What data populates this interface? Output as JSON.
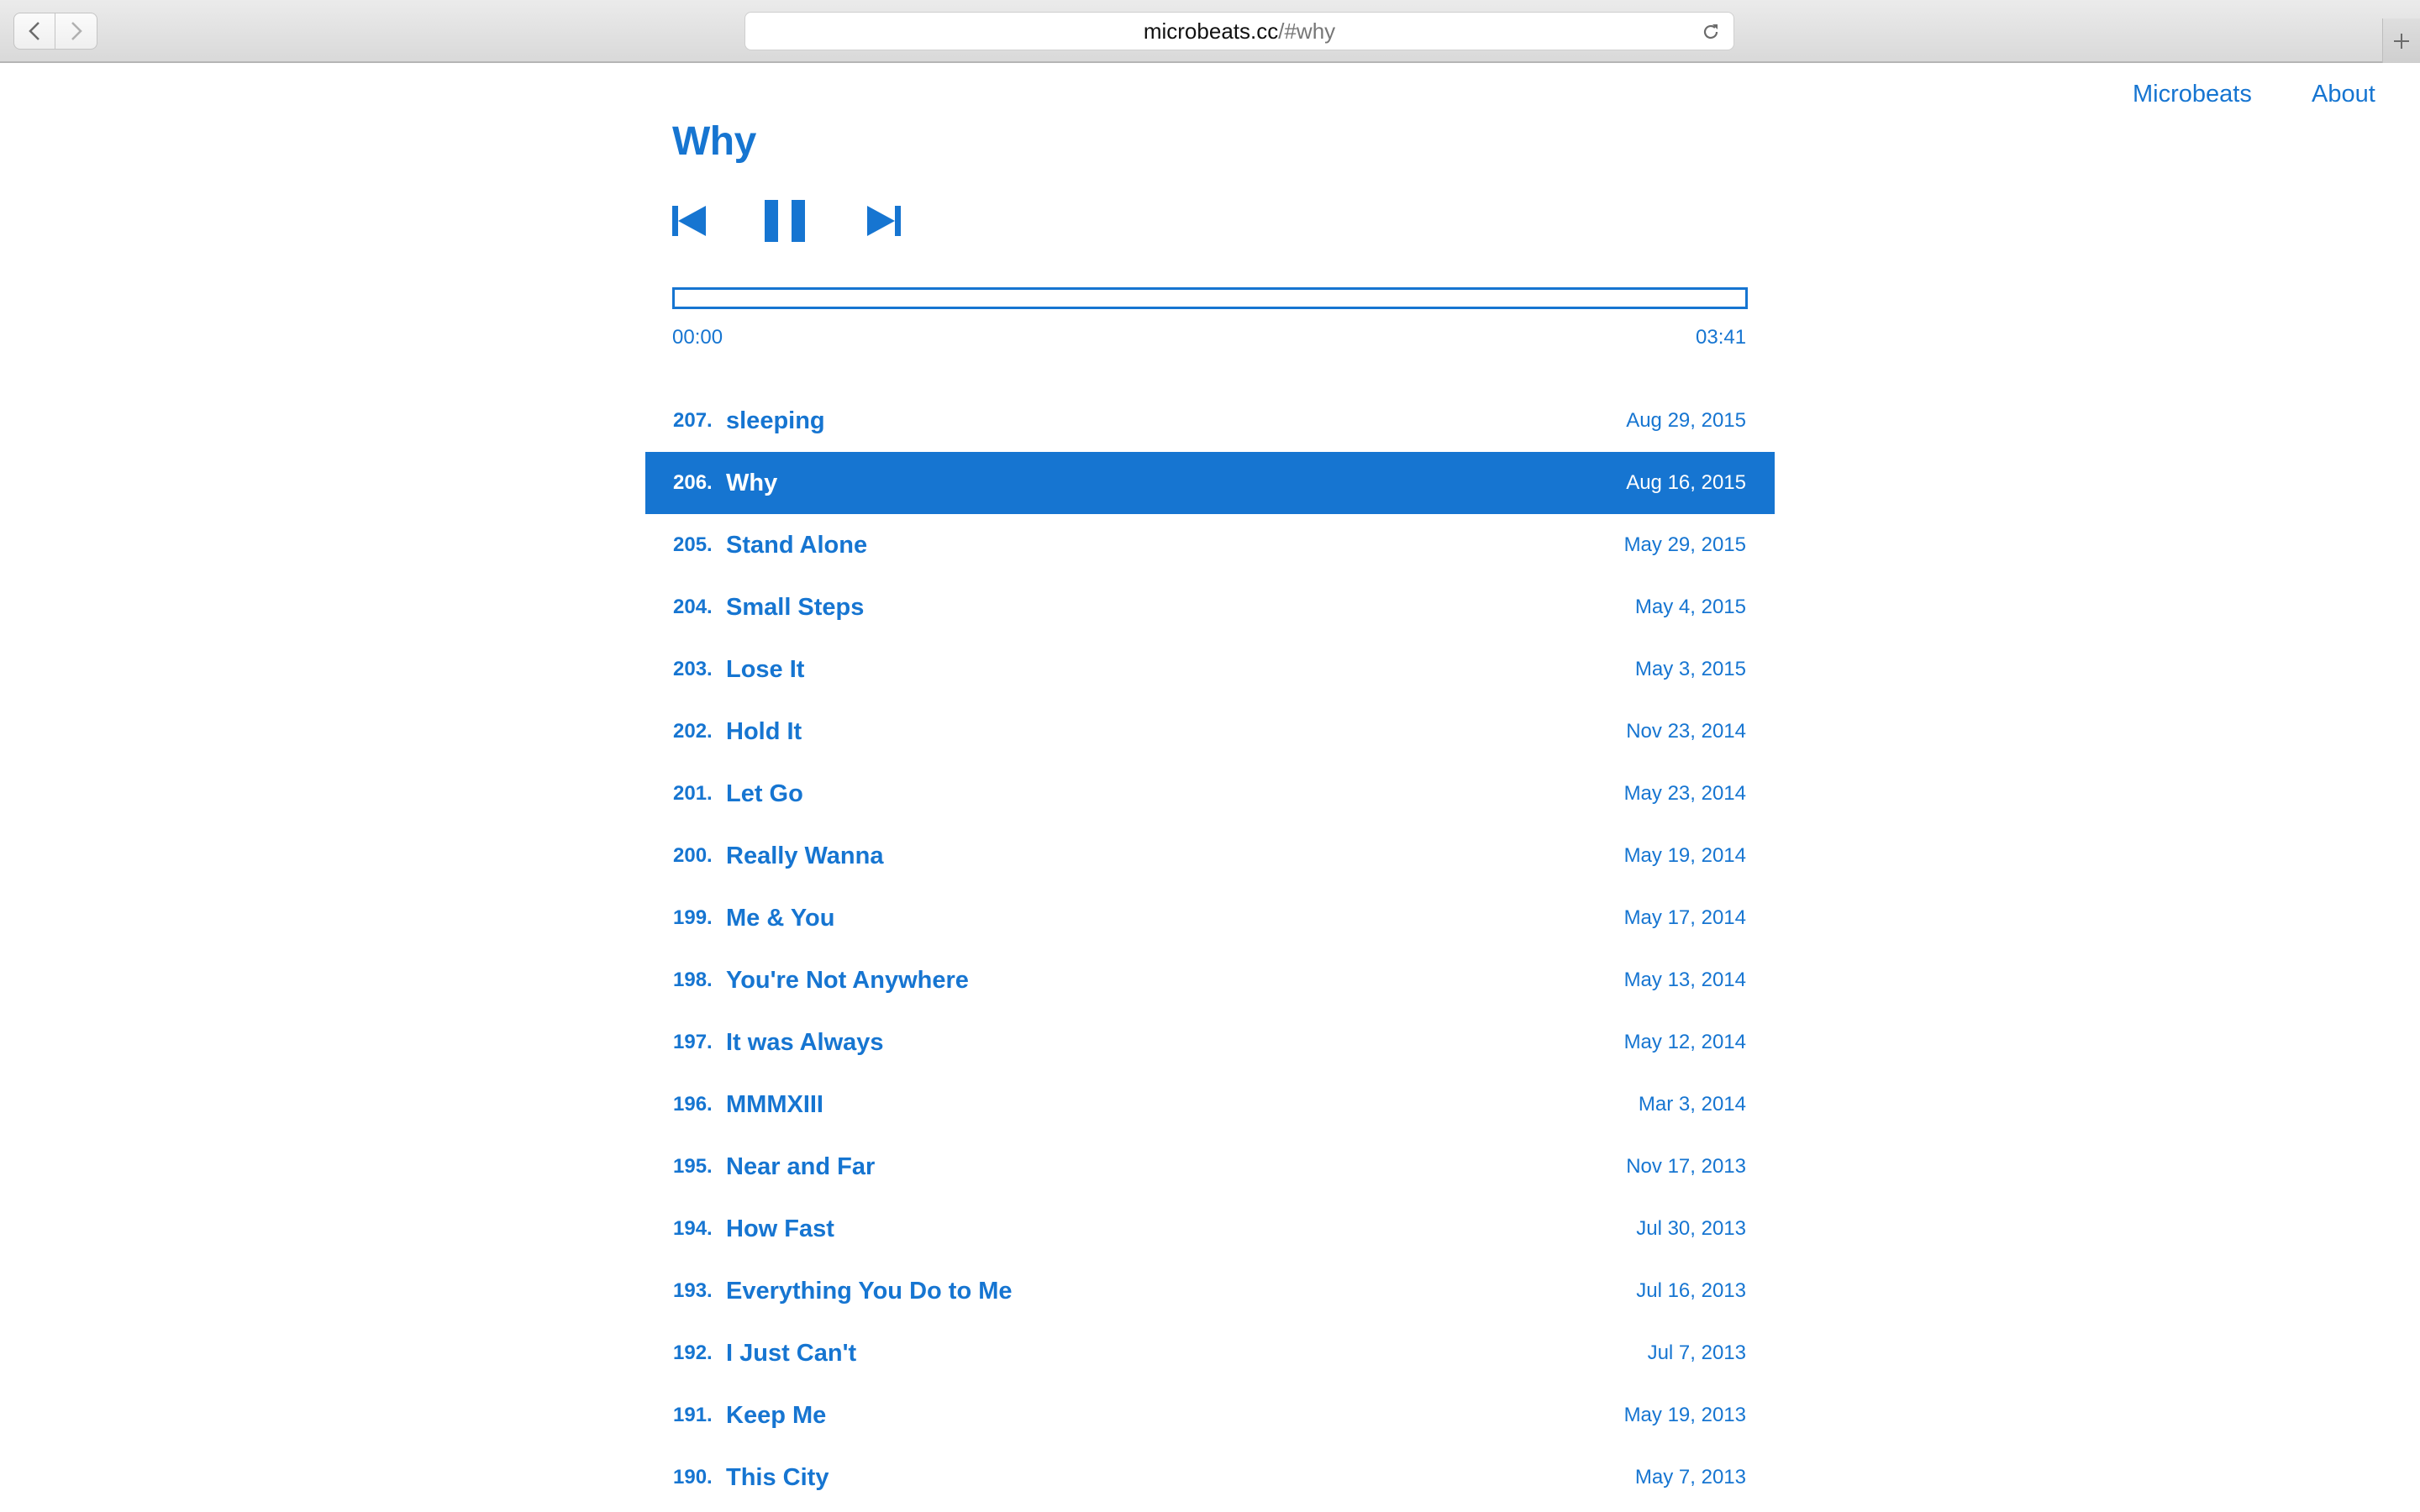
{
  "browser": {
    "url_host": "microbeats.cc",
    "url_path": "/#why",
    "back_icon": "chevron-left-icon",
    "forward_icon": "chevron-right-icon",
    "reload_icon": "reload-icon",
    "new_tab_icon": "plus-icon"
  },
  "nav": {
    "microbeats": "Microbeats",
    "about": "About"
  },
  "player": {
    "title": "Why",
    "current_time": "00:00",
    "total_time": "03:41",
    "progress_fraction": 0,
    "prev_icon": "skip-previous-icon",
    "pause_icon": "pause-icon",
    "next_icon": "skip-next-icon"
  },
  "colors": {
    "accent": "#1675d1",
    "active_text": "#ffffff"
  },
  "tracks": [
    {
      "num": "207.",
      "name": "sleeping",
      "date": "Aug 29, 2015",
      "active": false
    },
    {
      "num": "206.",
      "name": "Why",
      "date": "Aug 16, 2015",
      "active": true
    },
    {
      "num": "205.",
      "name": "Stand Alone",
      "date": "May 29, 2015",
      "active": false
    },
    {
      "num": "204.",
      "name": "Small Steps",
      "date": "May 4, 2015",
      "active": false
    },
    {
      "num": "203.",
      "name": "Lose It",
      "date": "May 3, 2015",
      "active": false
    },
    {
      "num": "202.",
      "name": "Hold It",
      "date": "Nov 23, 2014",
      "active": false
    },
    {
      "num": "201.",
      "name": "Let Go",
      "date": "May 23, 2014",
      "active": false
    },
    {
      "num": "200.",
      "name": "Really Wanna",
      "date": "May 19, 2014",
      "active": false
    },
    {
      "num": "199.",
      "name": "Me & You",
      "date": "May 17, 2014",
      "active": false
    },
    {
      "num": "198.",
      "name": "You're Not Anywhere",
      "date": "May 13, 2014",
      "active": false
    },
    {
      "num": "197.",
      "name": "It was Always",
      "date": "May 12, 2014",
      "active": false
    },
    {
      "num": "196.",
      "name": "MMMXIII",
      "date": "Mar 3, 2014",
      "active": false
    },
    {
      "num": "195.",
      "name": "Near and Far",
      "date": "Nov 17, 2013",
      "active": false
    },
    {
      "num": "194.",
      "name": "How Fast",
      "date": "Jul 30, 2013",
      "active": false
    },
    {
      "num": "193.",
      "name": "Everything You Do to Me",
      "date": "Jul 16, 2013",
      "active": false
    },
    {
      "num": "192.",
      "name": "I Just Can't",
      "date": "Jul 7, 2013",
      "active": false
    },
    {
      "num": "191.",
      "name": "Keep Me",
      "date": "May 19, 2013",
      "active": false
    },
    {
      "num": "190.",
      "name": "This City",
      "date": "May 7, 2013",
      "active": false
    }
  ]
}
